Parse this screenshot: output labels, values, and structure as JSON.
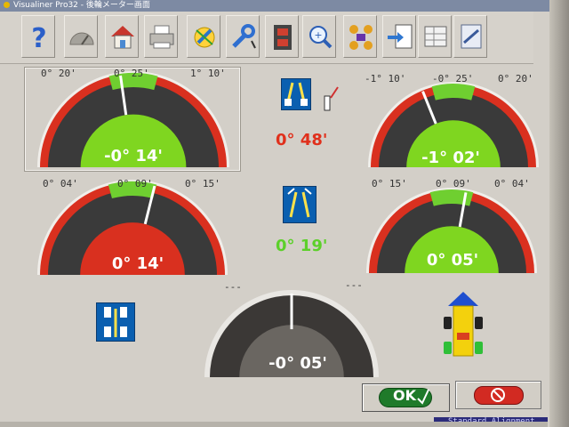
{
  "window": {
    "title": "Visualiner Pro32 - 後輪メーター画面"
  },
  "toolbar": {
    "buttons": [
      {
        "icon": "help-icon"
      },
      {
        "icon": "gauge-icon"
      },
      {
        "icon": "home-icon"
      },
      {
        "icon": "printer-icon"
      },
      {
        "icon": "angle-setup-icon"
      },
      {
        "icon": "adjust-wrench-icon"
      },
      {
        "icon": "film-icon"
      },
      {
        "icon": "zoom-icon"
      },
      {
        "icon": "flow-chart-icon"
      },
      {
        "icon": "report-icon"
      },
      {
        "icon": "spec-table-icon"
      },
      {
        "icon": "vehicle-data-icon"
      }
    ]
  },
  "colors": {
    "red": "#d9301f",
    "green": "#7fd620",
    "dark": "#3a3a3a",
    "band": "#6fcf30",
    "text_red": "#e0301c",
    "text_green": "#5cd02a"
  },
  "gauges": {
    "left_camber": {
      "tick_left": "0° 20'",
      "tick_center": "0° 25'",
      "tick_right": "1° 10'",
      "value": "-0° 14'",
      "needle_deg": -8,
      "fill": "green"
    },
    "right_camber": {
      "tick_left": "-1° 10'",
      "tick_center": "-0° 25'",
      "tick_right": "0° 20'",
      "value": "-1° 02'",
      "needle_deg": -22,
      "fill": "green"
    },
    "left_toe": {
      "tick_left": "0° 04'",
      "tick_center": "0° 09'",
      "tick_right": "0° 15'",
      "value": "0° 14'",
      "needle_deg": 14,
      "fill": "red"
    },
    "right_toe": {
      "tick_left": "0° 15'",
      "tick_center": "0° 09'",
      "tick_right": "0° 04'",
      "value": "0° 05'",
      "needle_deg": 10,
      "fill": "green"
    },
    "thrust": {
      "tick_left": "---",
      "tick_right": "---",
      "value": "-0° 05'",
      "needle_deg": 0,
      "fill": "dark"
    }
  },
  "center": {
    "cross_camber": "0° 48'",
    "total_toe": "0° 19'"
  },
  "buttons": {
    "ok_label": "OK"
  },
  "status": {
    "mode": "Standard Alignment"
  }
}
